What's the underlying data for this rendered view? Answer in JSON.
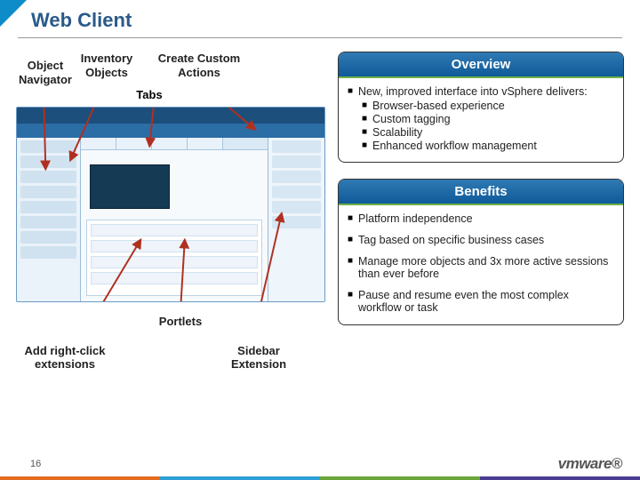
{
  "title": "Web Client",
  "slide_number": "16",
  "logo_text": "vmware",
  "callouts": {
    "object_navigator": "Object Navigator",
    "inventory_objects": "Inventory Objects",
    "create_custom_actions": "Create Custom Actions",
    "tabs": "Tabs",
    "portlets": "Portlets",
    "add_right_click_ext": "Add right-click extensions",
    "sidebar_extension": "Sidebar Extension"
  },
  "overview": {
    "header": "Overview",
    "lead": "New, improved interface into vSphere delivers:",
    "items": [
      "Browser-based experience",
      "Custom tagging",
      "Scalability",
      "Enhanced workflow management"
    ]
  },
  "benefits": {
    "header": "Benefits",
    "items": [
      "Platform independence",
      "Tag based on specific business cases",
      "Manage more objects and 3x more active sessions than ever before",
      "Pause and resume even the most complex workflow or task"
    ]
  }
}
